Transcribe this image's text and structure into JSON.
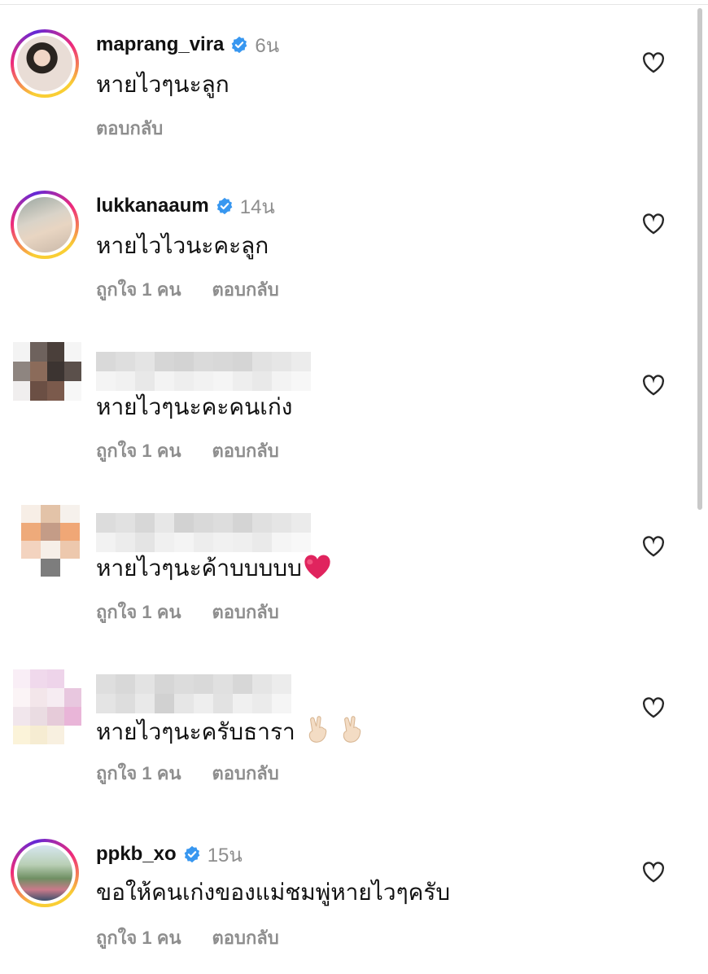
{
  "comments": [
    {
      "username": "maprang_vira",
      "verified": true,
      "time": "6น",
      "text": "หายไวๆนะลูก",
      "likes_label": "",
      "reply_label": "ตอบกลับ"
    },
    {
      "username": "lukkanaaum",
      "verified": true,
      "time": "14น",
      "text": "หายไวไวนะคะลูก",
      "likes_label": "ถูกใจ 1 คน",
      "reply_label": "ตอบกลับ"
    },
    {
      "username": "",
      "verified": false,
      "time": "",
      "text": "หายไวๆนะคะคนเก่ง",
      "likes_label": "ถูกใจ 1 คน",
      "reply_label": "ตอบกลับ"
    },
    {
      "username": "",
      "verified": false,
      "time": "",
      "text": "หายไวๆนะค้าบบบบบ",
      "likes_label": "ถูกใจ 1 คน",
      "reply_label": "ตอบกลับ"
    },
    {
      "username": "",
      "verified": false,
      "time": "",
      "text": "หายไวๆนะครับธารา",
      "likes_label": "ถูกใจ 1 คน",
      "reply_label": "ตอบกลับ"
    },
    {
      "username": "ppkb_xo",
      "verified": true,
      "time": "15น",
      "text": "ขอให้คนเก่งของแม่ชมพู่หายไวๆครับ",
      "likes_label": "ถูกใจ 1 คน",
      "reply_label": "ตอบกลับ"
    }
  ],
  "icons": {
    "verified": "verified-badge-icon",
    "like": "heart-outline-icon",
    "emoji_heart": "red-heart-emoji",
    "emoji_victory": "victory-hand-emoji"
  },
  "colors": {
    "verified_blue": "#3897f0",
    "secondary_text": "#8e8e8e",
    "heart_red": "#e0245e"
  }
}
